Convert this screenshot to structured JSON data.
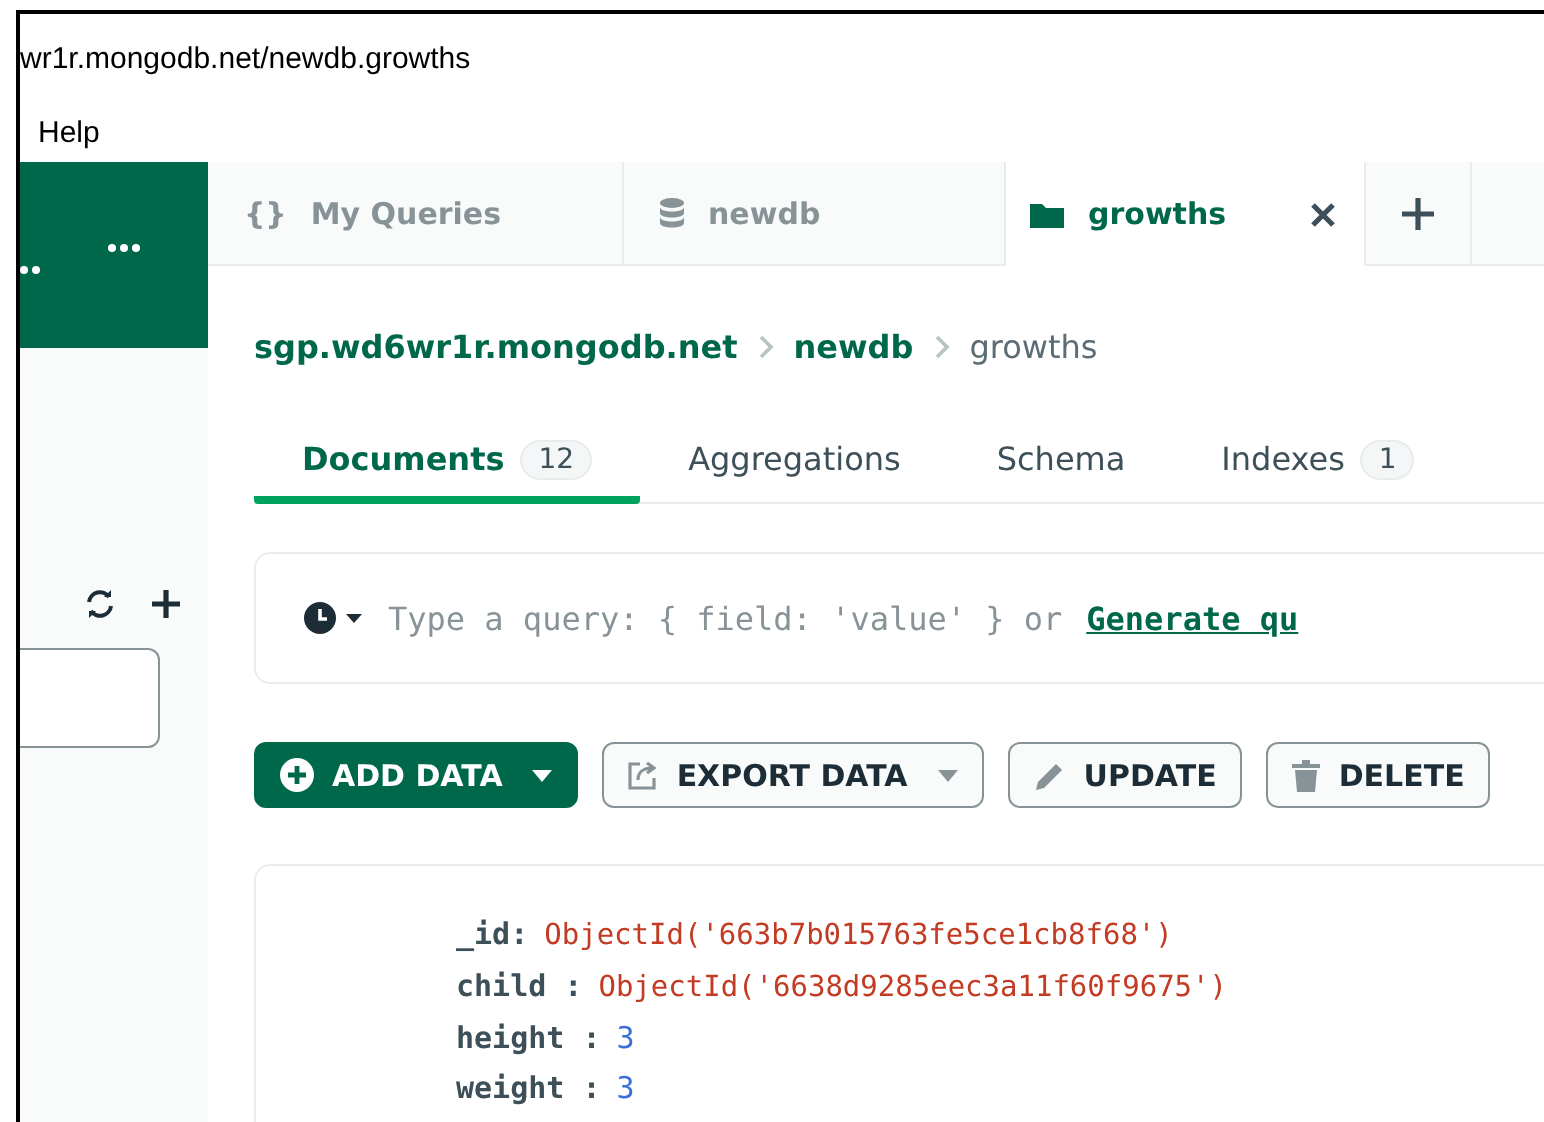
{
  "window": {
    "title": "wr1r.mongodb.net/newdb.growths"
  },
  "menu": [
    "Help"
  ],
  "tabs": [
    {
      "kind": "queries",
      "icon": "{}",
      "label": "My Queries",
      "selected": false
    },
    {
      "kind": "database",
      "label": "newdb",
      "selected": false
    },
    {
      "kind": "collection",
      "label": "growths",
      "selected": true
    }
  ],
  "breadcrumb": [
    "sgp.wd6wr1r.mongodb.net",
    "newdb",
    "growths"
  ],
  "subtabs": [
    {
      "label": "Documents",
      "count": "12",
      "selected": true
    },
    {
      "label": "Aggregations",
      "selected": false
    },
    {
      "label": "Schema",
      "selected": false
    },
    {
      "label": "Indexes",
      "count": "1",
      "selected": false
    }
  ],
  "query": {
    "placeholder": "Type a query: { field: 'value' } or",
    "link": "Generate qu"
  },
  "actions": [
    {
      "kind": "add",
      "label": "ADD DATA",
      "primary": true,
      "dropdown": true
    },
    {
      "kind": "export",
      "label": "EXPORT DATA",
      "primary": false,
      "dropdown": true
    },
    {
      "kind": "update",
      "label": "UPDATE",
      "primary": false,
      "dropdown": false
    },
    {
      "kind": "delete",
      "label": "DELETE",
      "primary": false,
      "dropdown": false
    }
  ],
  "document": [
    {
      "key": "_id:",
      "kind": "objectid",
      "value": "ObjectId('663b7b015763fe5ce1cb8f68')"
    },
    {
      "key": "child :",
      "kind": "objectid",
      "value": "ObjectId('6638d9285eec3a11f60f9675')"
    },
    {
      "key": "height :",
      "kind": "number",
      "value": "3"
    },
    {
      "key": "weight :",
      "kind": "number",
      "value": "3"
    }
  ]
}
